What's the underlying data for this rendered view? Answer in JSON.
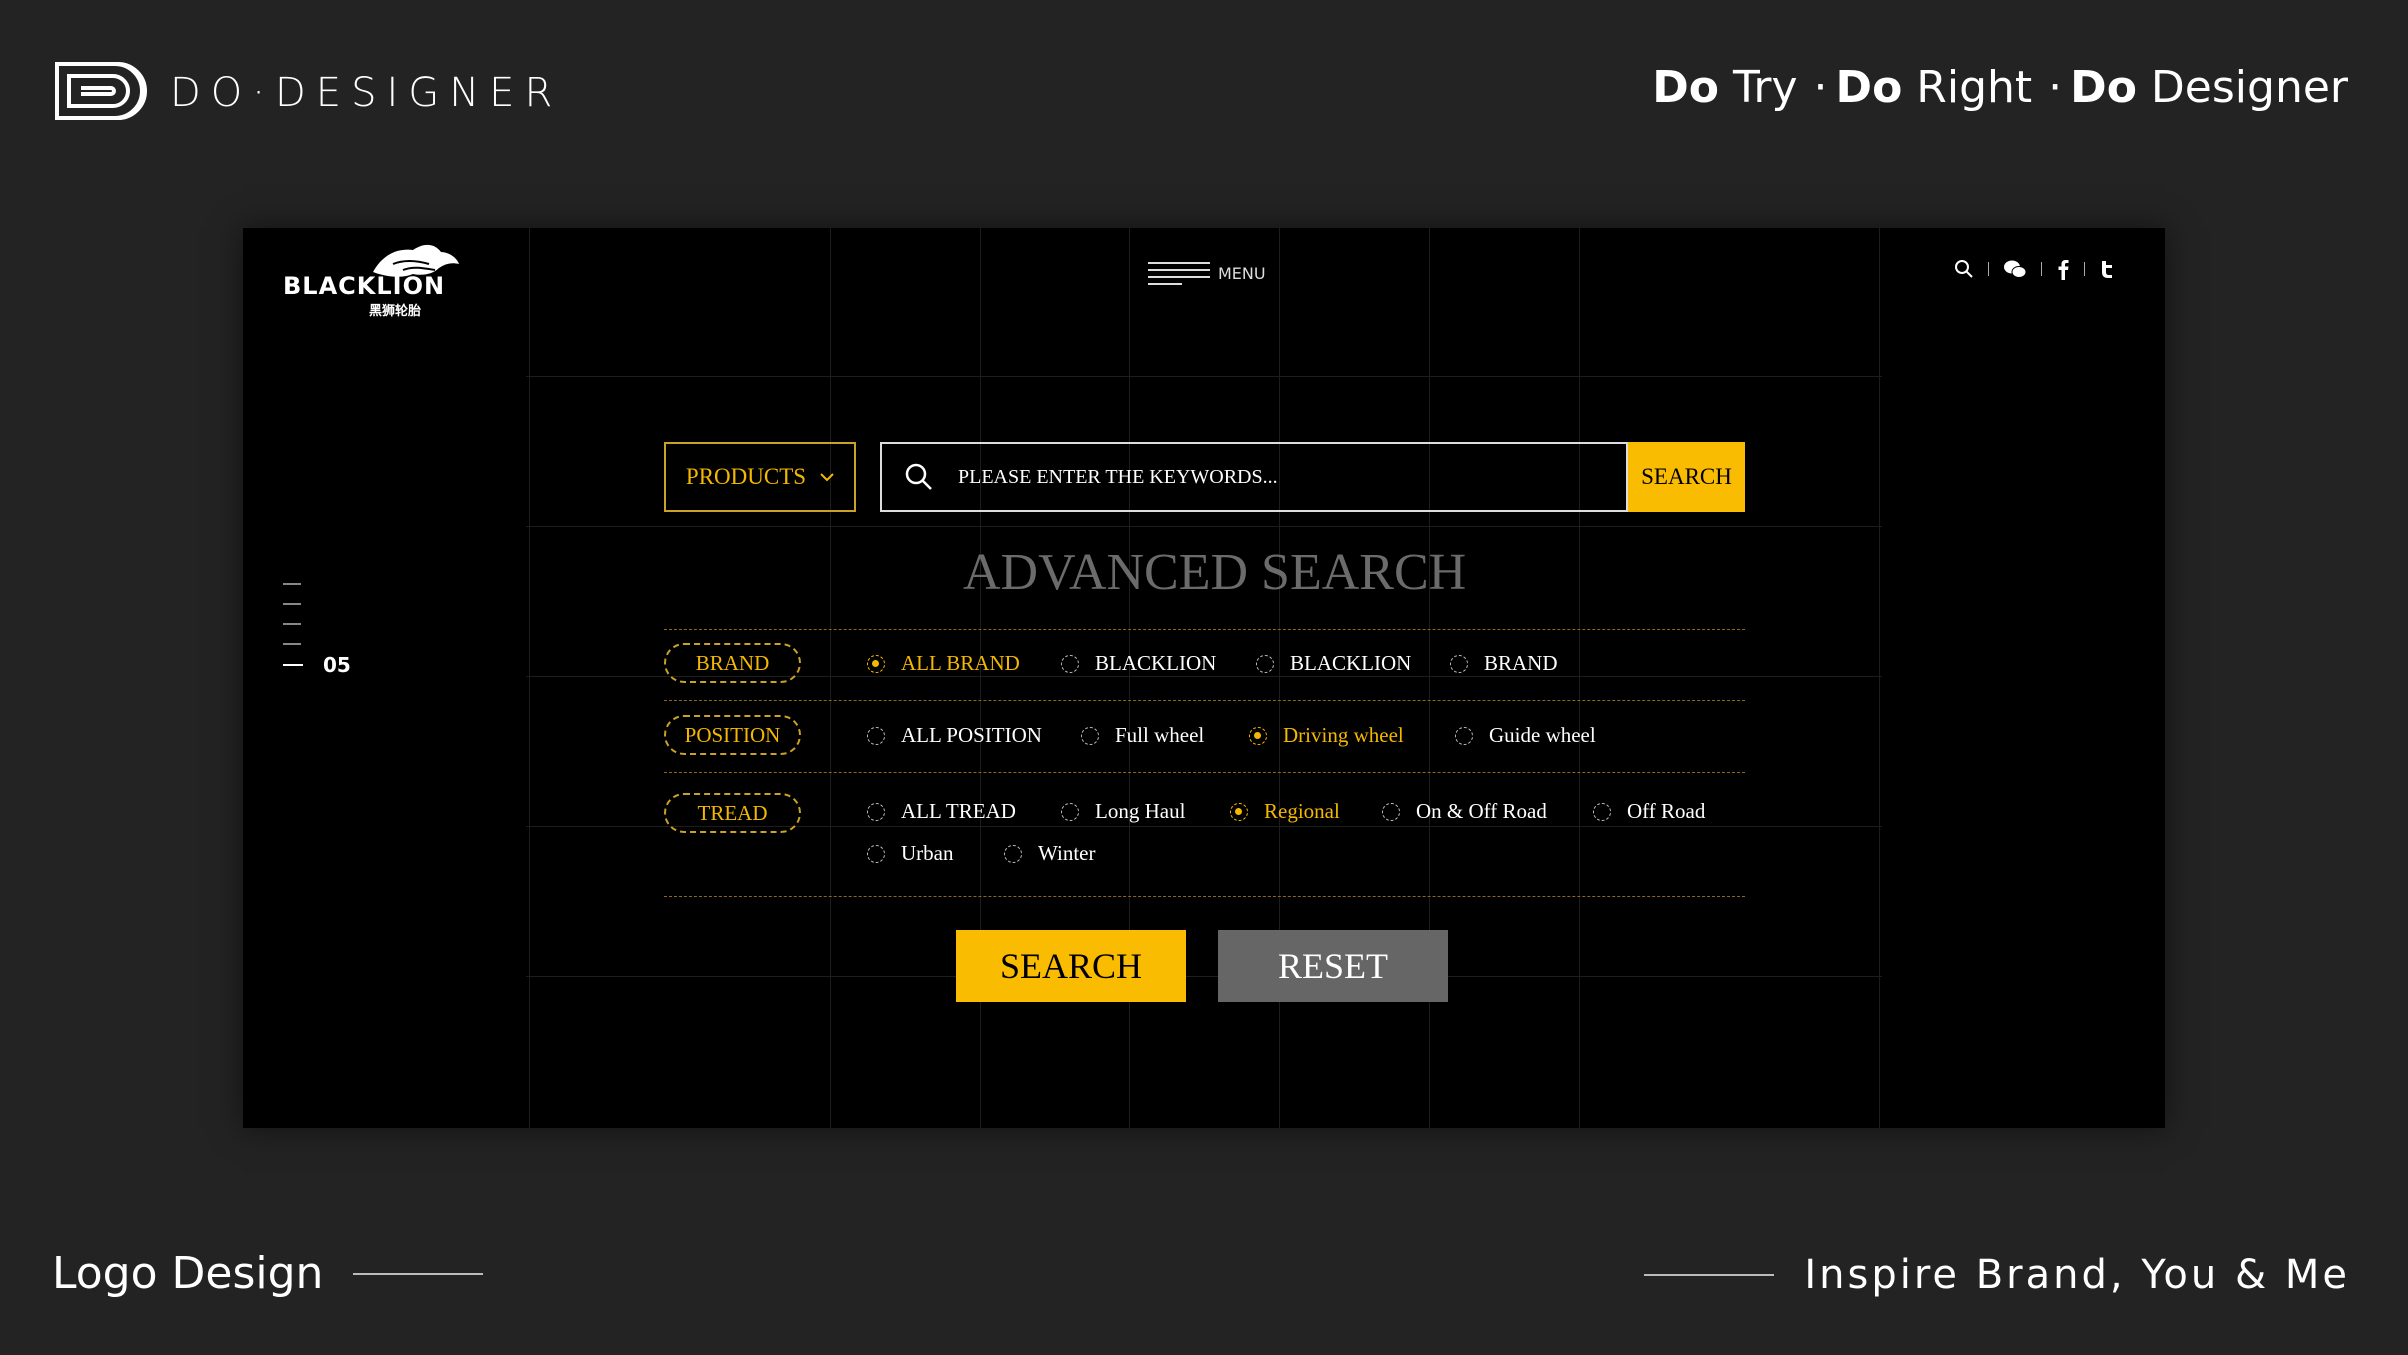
{
  "brand": {
    "name": "DO·DESIGNER",
    "tagline": [
      {
        "bold": "Do",
        "rest": " Try"
      },
      {
        "bold": "Do",
        "rest": " Right"
      },
      {
        "bold": "Do",
        "rest": " Designer"
      }
    ],
    "tagline_sep": "·",
    "footer_left": "Logo Design",
    "footer_right": "Inspire Brand, You & Me"
  },
  "site": {
    "logo_text": "BLACKLION",
    "logo_subtext": "黑狮轮胎",
    "menu_label": "MENU",
    "social_icons": [
      "search-icon",
      "wechat-icon",
      "facebook-icon",
      "twitter-icon"
    ],
    "page_number": "05"
  },
  "search": {
    "category_label": "PRODUCTS",
    "placeholder": "PLEASE ENTER THE KEYWORDS...",
    "submit_label": "SEARCH"
  },
  "advanced": {
    "title": "ADVANCED SEARCH",
    "filters": [
      {
        "label": "BRAND",
        "options": [
          {
            "label": "ALL BRAND",
            "selected": true
          },
          {
            "label": "BLACKLION",
            "selected": false
          },
          {
            "label": "BLACKLION",
            "selected": false
          },
          {
            "label": "BRAND",
            "selected": false
          }
        ]
      },
      {
        "label": "POSITION",
        "options": [
          {
            "label": "ALL POSITION",
            "selected": false
          },
          {
            "label": "Full wheel",
            "selected": false
          },
          {
            "label": "Driving wheel",
            "selected": true
          },
          {
            "label": "Guide wheel",
            "selected": false
          }
        ]
      },
      {
        "label": "TREAD",
        "options": [
          {
            "label": "ALL TREAD",
            "selected": false
          },
          {
            "label": "Long Haul",
            "selected": false
          },
          {
            "label": "Regional",
            "selected": true
          },
          {
            "label": "On & Off Road",
            "selected": false
          },
          {
            "label": "Off Road",
            "selected": false
          },
          {
            "label": "Urban",
            "selected": false
          },
          {
            "label": "Winter",
            "selected": false
          }
        ]
      }
    ],
    "search_button": "SEARCH",
    "reset_button": "RESET"
  },
  "colors": {
    "accent": "#f9bc00",
    "background": "#232323",
    "panel": "#000000",
    "reset": "#666666"
  }
}
